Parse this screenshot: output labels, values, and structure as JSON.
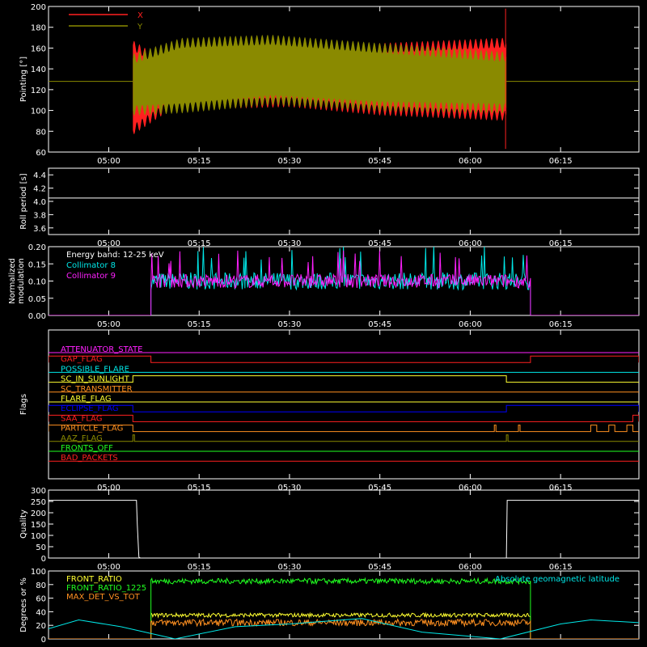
{
  "colors": {
    "background": "#000000",
    "axes": "#ffffff",
    "red": "#ff2020",
    "olive": "#8a8a00",
    "cyan": "#00e8e8",
    "magenta": "#ff20ff",
    "green": "#20ff20",
    "yellow": "#ffff30",
    "orange": "#ff9020"
  },
  "time_axis": {
    "start": "04:50",
    "end": "06:28",
    "ticks": [
      "05:00",
      "05:15",
      "05:30",
      "05:45",
      "06:00",
      "06:15"
    ]
  },
  "chart_data": [
    {
      "type": "line",
      "name_hint": "pointing",
      "ylabel": "Pointing [°]",
      "ylim": [
        60,
        200
      ],
      "yticks": [
        "60",
        "80",
        "100",
        "120",
        "140",
        "160",
        "180",
        "200"
      ],
      "legend": [
        "X",
        "Y"
      ],
      "baseline_value": 128,
      "oscillation": {
        "t_start": "05:04",
        "t_end": "06:06"
      },
      "series": [
        {
          "name": "X",
          "color": "red",
          "upper": [
            [
              5.07,
              162
            ],
            [
              5.17,
              140
            ],
            [
              5.5,
              150
            ],
            [
              5.75,
              160
            ],
            [
              6.08,
              165
            ]
          ],
          "lower": [
            [
              5.07,
              82
            ],
            [
              5.17,
              105
            ],
            [
              5.5,
              108
            ],
            [
              5.75,
              100
            ],
            [
              6.08,
              95
            ]
          ]
        },
        {
          "name": "Y",
          "color": "olive",
          "upper": [
            [
              5.07,
              150
            ],
            [
              5.2,
              165
            ],
            [
              5.45,
              168
            ],
            [
              5.75,
              160
            ],
            [
              6.08,
              152
            ]
          ],
          "lower": [
            [
              5.07,
              100
            ],
            [
              5.2,
              102
            ],
            [
              5.45,
              110
            ],
            [
              5.75,
              104
            ],
            [
              6.08,
              102
            ]
          ]
        }
      ]
    },
    {
      "type": "line",
      "name_hint": "roll-period",
      "ylabel": "Roll period [s]",
      "ylim": [
        3.5,
        4.5
      ],
      "yticks": [
        "3.6",
        "3.8",
        "4.0",
        "4.2",
        "4.4"
      ],
      "series": [
        {
          "name": "",
          "constant": 4.05
        }
      ]
    },
    {
      "type": "line",
      "name_hint": "modulation",
      "ylabel": "Normalized modulation",
      "ylabel_lines": [
        "Normalized",
        "modulation"
      ],
      "ylim": [
        0,
        0.2
      ],
      "yticks": [
        "0.00",
        "0.05",
        "0.10",
        "0.15",
        "0.20"
      ],
      "legend": [
        "Energy band: 12-25 keV",
        "Collimator 8",
        "Collimator 9"
      ],
      "active": {
        "t_start": "05:07",
        "t_end": "06:10"
      },
      "series": [
        {
          "name": "Collimator 8",
          "color": "cyan",
          "mean": 0.1,
          "spread": 0.025
        },
        {
          "name": "Collimator 9",
          "color": "magenta",
          "mean": 0.1,
          "spread": 0.02
        }
      ]
    },
    {
      "type": "line",
      "name_hint": "flags",
      "ylabel": "Flags",
      "flags": [
        {
          "label": "ATTENUATOR_STATE",
          "color": "magenta"
        },
        {
          "label": "GAP_FLAG",
          "color": "red",
          "high_segments": [
            [
              "04:50",
              "05:07"
            ],
            [
              "06:10",
              "06:28"
            ]
          ]
        },
        {
          "label": "POSSIBLE_FLARE",
          "color": "cyan"
        },
        {
          "label": "SC_IN_SUNLIGHT",
          "color": "yellow",
          "high_segments": [
            [
              "05:04",
              "06:06"
            ]
          ]
        },
        {
          "label": "SC_TRANSMITTER",
          "color": "orange"
        },
        {
          "label": "FLARE_FLAG",
          "color": "yellow"
        },
        {
          "label": "ECLIPSE_FLAG",
          "color": "blue",
          "high_segments": [
            [
              "04:50",
              "05:04"
            ],
            [
              "06:06",
              "06:28"
            ]
          ]
        },
        {
          "label": "SAA_FLAG",
          "color": "red",
          "high_segments": [
            [
              "04:50",
              "05:04"
            ],
            [
              "06:27",
              "06:28"
            ]
          ]
        },
        {
          "label": "PARTICLE_FLAG",
          "color": "orange",
          "high_segments": [
            [
              "04:50",
              "05:04"
            ],
            [
              "06:04",
              "06:04"
            ],
            [
              "06:08",
              "06:08"
            ],
            [
              "06:20",
              "06:21"
            ],
            [
              "06:23",
              "06:24"
            ],
            [
              "06:26",
              "06:27"
            ]
          ]
        },
        {
          "label": "AAZ_FLAG",
          "color": "olive",
          "high_segments": [
            [
              "05:04",
              "05:04"
            ],
            [
              "06:06",
              "06:06"
            ]
          ]
        },
        {
          "label": "FRONTS_OFF",
          "color": "green"
        },
        {
          "label": "BAD_PACKETS",
          "color": "red"
        }
      ]
    },
    {
      "type": "line",
      "name_hint": "quality",
      "ylabel": "Quality",
      "ylim": [
        0,
        300
      ],
      "yticks": [
        "0",
        "50",
        "100",
        "150",
        "200",
        "250",
        "300"
      ],
      "series": [
        {
          "name": "",
          "high": 255,
          "low_segment": [
            "05:05",
            "06:06"
          ]
        }
      ]
    },
    {
      "type": "line",
      "name_hint": "ratios",
      "ylabel": "Degrees or %",
      "ylim": [
        0,
        100
      ],
      "yticks": [
        "0",
        "20",
        "40",
        "60",
        "80",
        "100"
      ],
      "legend": [
        "FRONT_RATIO",
        "FRONT_RATIO_1225",
        "MAX_DET_VS_TOT"
      ],
      "right_legend": "Absolute geomagnetic latitude",
      "active": {
        "t_start": "05:07",
        "t_end": "06:10"
      },
      "series": [
        {
          "name": "FRONT_RATIO",
          "color": "yellow",
          "mean": 35,
          "spread": 3
        },
        {
          "name": "FRONT_RATIO_1225",
          "color": "green",
          "mean": 85,
          "spread": 4
        },
        {
          "name": "MAX_DET_VS_TOT",
          "color": "orange",
          "mean": 24,
          "spread": 5
        },
        {
          "name": "Absolute geomagnetic latitude",
          "color": "cyan",
          "points": [
            [
              "04:50",
              15
            ],
            [
              "04:55",
              28
            ],
            [
              "05:02",
              18
            ],
            [
              "05:11",
              0
            ],
            [
              "05:21",
              18
            ],
            [
              "05:30",
              22
            ],
            [
              "05:42",
              30
            ],
            [
              "05:52",
              10
            ],
            [
              "06:05",
              0
            ],
            [
              "06:15",
              22
            ],
            [
              "06:20",
              28
            ],
            [
              "06:28",
              24
            ]
          ]
        }
      ]
    }
  ]
}
